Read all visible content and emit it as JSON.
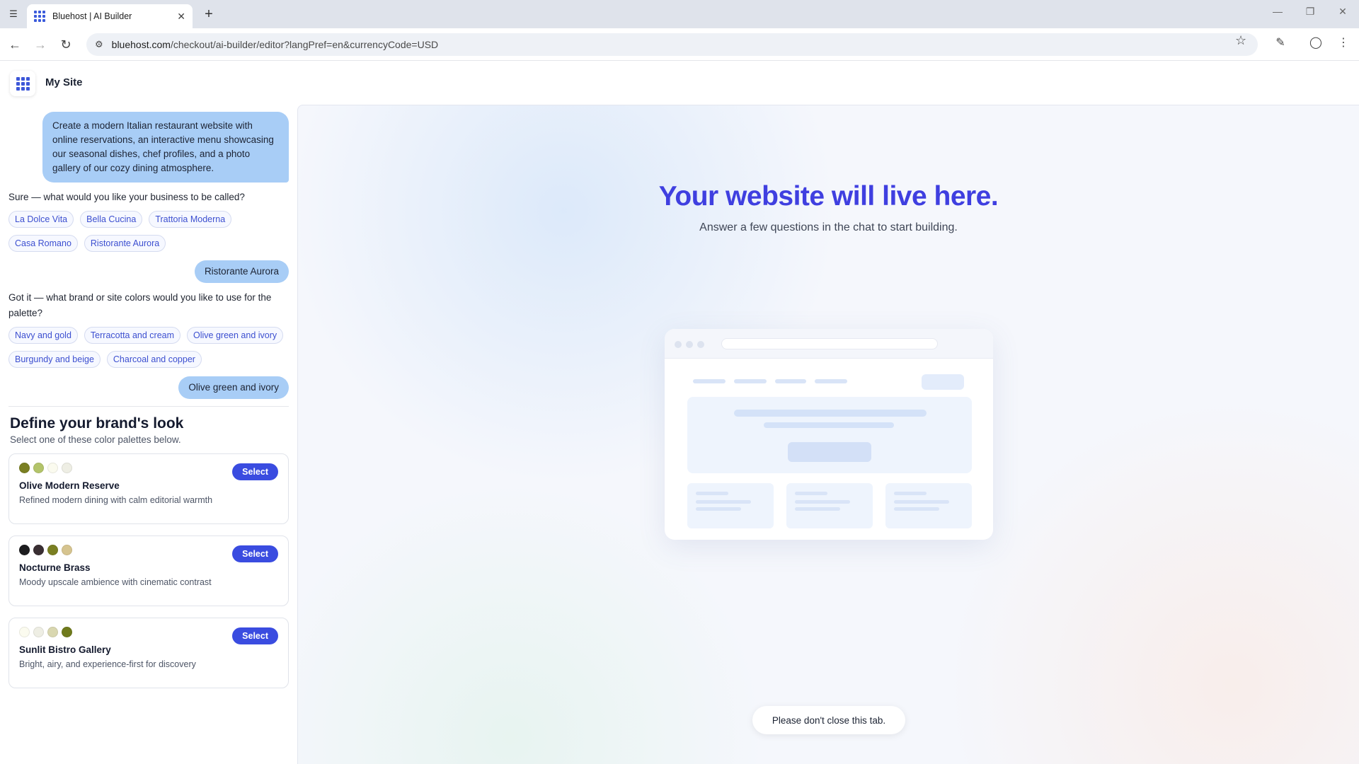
{
  "browser": {
    "tab_title": "Bluehost | AI Builder",
    "url_host": "bluehost.com",
    "url_path": "/checkout/ai-builder/editor?langPref=en&currencyCode=USD"
  },
  "app": {
    "title": "My Site"
  },
  "chat": {
    "prompt": "Create a modern Italian restaurant website with online reservations, an interactive menu showcasing our seasonal dishes, chef profiles, and a photo gallery of our cozy dining atmosphere.",
    "q_name": "Sure — what would you like your business to be called?",
    "name_options": [
      "La Dolce Vita",
      "Bella Cucina",
      "Trattoria Moderna",
      "Casa Romano",
      "Ristorante Aurora"
    ],
    "name_answer": "Ristorante Aurora",
    "q_colors": "Got it — what brand or site colors would you like to use for the palette?",
    "color_options": [
      "Navy and gold",
      "Terracotta and cream",
      "Olive green and ivory",
      "Burgundy and beige",
      "Charcoal and copper"
    ],
    "color_answer": "Olive green and ivory"
  },
  "brand": {
    "title": "Define your brand's look",
    "subtitle": "Select one of these color palettes below.",
    "select_label": "Select",
    "palettes": [
      {
        "name": "Olive Modern Reserve",
        "desc": "Refined modern dining with calm editorial warmth",
        "colors": [
          "#7a7f22",
          "#b3c46a",
          "#fbfbef",
          "#eeeee4"
        ]
      },
      {
        "name": "Nocturne Brass",
        "desc": "Moody upscale ambience with cinematic contrast",
        "colors": [
          "#1d1d1f",
          "#3a2f33",
          "#7a7f22",
          "#d6c48f"
        ]
      },
      {
        "name": "Sunlit Bistro Gallery",
        "desc": "Bright, airy, and experience-first for discovery",
        "colors": [
          "#fbfbef",
          "#eeeee4",
          "#d9d7b0",
          "#6f7a1c"
        ]
      }
    ]
  },
  "preview": {
    "headline": "Your website will live here.",
    "subline": "Answer a few questions in the chat to start building.",
    "toast": "Please don't close this tab."
  }
}
